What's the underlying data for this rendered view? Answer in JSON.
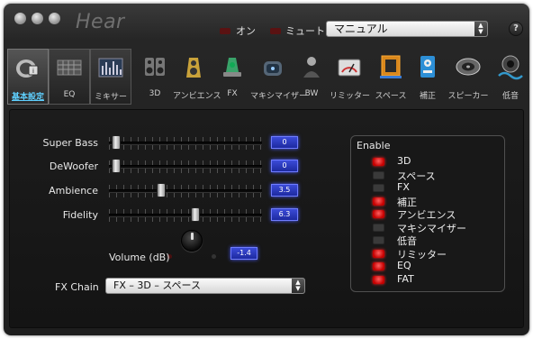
{
  "app": {
    "name": "Hear"
  },
  "header": {
    "on_label": "オン",
    "mute_label": "ミュート",
    "preset": "マニュアル",
    "help": "?"
  },
  "tabs": [
    {
      "id": "basic",
      "label": "基本設定",
      "icon": "speaker-settings-icon",
      "active": true
    },
    {
      "id": "eq",
      "label": "EQ",
      "icon": "equalizer-grid-icon",
      "active": false
    },
    {
      "id": "mixer",
      "label": "ミキサー",
      "icon": "mixer-bars-icon",
      "active": false
    },
    {
      "id": "3d",
      "label": "3D",
      "icon": "speakers-3d-icon",
      "active": false
    },
    {
      "id": "ambience",
      "label": "アンビエンス",
      "icon": "ambience-speaker-icon",
      "active": false
    },
    {
      "id": "fx",
      "label": "FX",
      "icon": "fx-lamp-icon",
      "active": false
    },
    {
      "id": "maximizer",
      "label": "マキシマイザー",
      "icon": "maximizer-icon",
      "active": false
    },
    {
      "id": "bw",
      "label": "BW",
      "icon": "brainwave-icon",
      "active": false
    },
    {
      "id": "limiter",
      "label": "リミッター",
      "icon": "limiter-meter-icon",
      "active": false
    },
    {
      "id": "space",
      "label": "スペース",
      "icon": "space-room-icon",
      "active": false
    },
    {
      "id": "correction",
      "label": "補正",
      "icon": "correction-speaker-icon",
      "active": false
    },
    {
      "id": "speaker",
      "label": "スピーカー",
      "icon": "speaker-disc-icon",
      "active": false
    },
    {
      "id": "bass",
      "label": "低音",
      "icon": "bass-wave-icon",
      "active": false
    }
  ],
  "sliders": [
    {
      "label": "Super Bass",
      "value": "0",
      "level": 0.02
    },
    {
      "label": "DeWoofer",
      "value": "0",
      "level": 0.02
    },
    {
      "label": "Ambience",
      "value": "3.5",
      "level": 0.33
    },
    {
      "label": "Fidelity",
      "value": "6.3",
      "level": 0.57
    }
  ],
  "volume": {
    "label": "Volume (dB)",
    "value": "-1.4"
  },
  "fx_chain": {
    "label": "FX Chain",
    "value": "FX – 3D – スペース"
  },
  "enable": {
    "title": "Enable",
    "items": [
      {
        "label": "3D",
        "on": true
      },
      {
        "label": "スペース",
        "on": false
      },
      {
        "label": "FX",
        "on": false
      },
      {
        "label": "補正",
        "on": true
      },
      {
        "label": "アンビエンス",
        "on": true
      },
      {
        "label": "マキシマイザー",
        "on": false
      },
      {
        "label": "低音",
        "on": false
      },
      {
        "label": "リミッター",
        "on": true
      },
      {
        "label": "EQ",
        "on": true
      },
      {
        "label": "FAT",
        "on": true
      }
    ]
  },
  "colors": {
    "accent": "#5fd0ff",
    "led_on": "#e01010",
    "value_box": "#2a3ac0"
  }
}
